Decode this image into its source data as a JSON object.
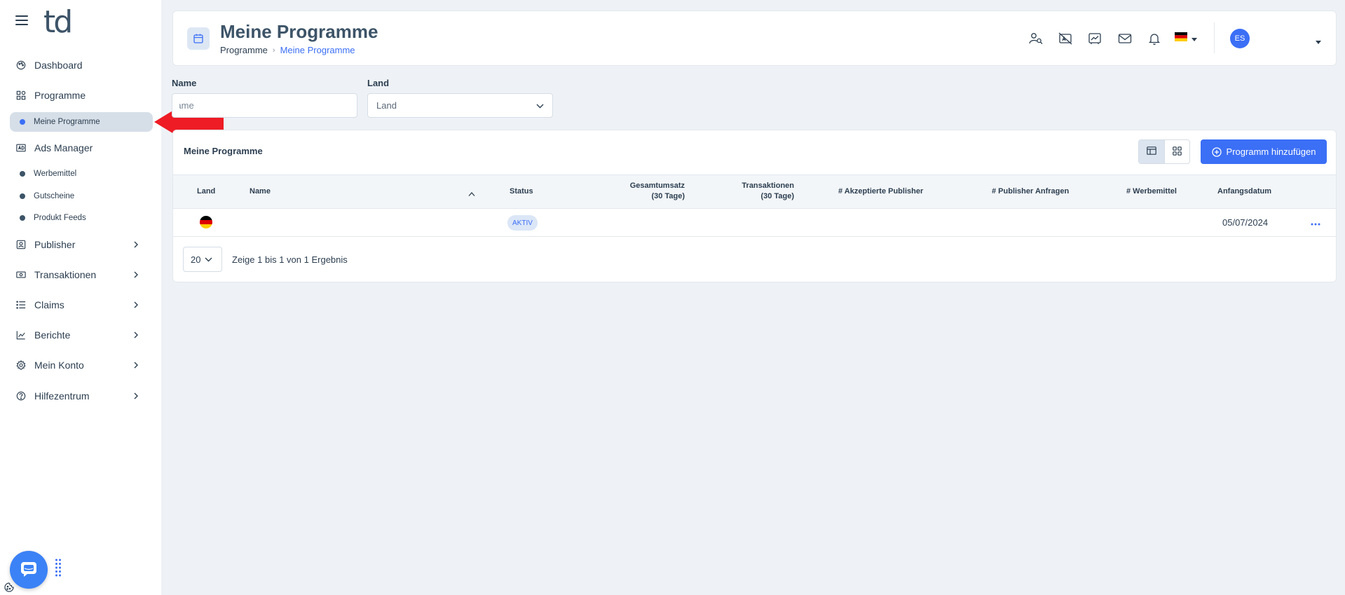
{
  "brand": {
    "logo_text": "td",
    "accent": "#3b6ff5"
  },
  "sidebar": {
    "items": [
      {
        "label": "Dashboard",
        "icon": "palette-icon"
      },
      {
        "label": "Programme",
        "icon": "grid-icon"
      },
      {
        "label": "Meine Programme",
        "active": true
      },
      {
        "label": "Ads Manager",
        "icon": "ad-icon"
      },
      {
        "label": "Werbemittel"
      },
      {
        "label": "Gutscheine"
      },
      {
        "label": "Produkt Feeds"
      },
      {
        "label": "Publisher",
        "icon": "user-badge-icon",
        "expandable": true
      },
      {
        "label": "Transaktionen",
        "icon": "money-icon",
        "expandable": true
      },
      {
        "label": "Claims",
        "icon": "list-icon",
        "expandable": true
      },
      {
        "label": "Berichte",
        "icon": "chart-line-icon",
        "expandable": true
      },
      {
        "label": "Mein Konto",
        "icon": "gear-icon",
        "expandable": true
      },
      {
        "label": "Hilfezentrum",
        "icon": "help-icon",
        "expandable": true
      }
    ]
  },
  "header": {
    "title": "Meine Programme",
    "breadcrumb": {
      "root": "Programme",
      "current": "Meine Programme"
    },
    "user": {
      "initials": "ES"
    },
    "language": "de"
  },
  "filters": {
    "name_label": "Name",
    "name_placeholder": "Name",
    "land_label": "Land",
    "land_value": "Land"
  },
  "table": {
    "title": "Meine Programme",
    "add_button_label": "Programm hinzufügen",
    "columns": {
      "land": "Land",
      "name": "Name",
      "status": "Status",
      "gesamtumsatz": "Gesamtumsatz",
      "gesamtumsatz_sub": "(30 Tage)",
      "transaktionen": "Transaktionen",
      "transaktionen_sub": "(30 Tage)",
      "akzeptierte": "# Akzeptierte Publisher",
      "anfragen": "# Publisher Anfragen",
      "werbemittel": "# Werbemittel",
      "anfangsdatum": "Anfangsdatum"
    },
    "rows": [
      {
        "land": "DE",
        "name": "",
        "status": "AKTIV",
        "gesamtumsatz": "",
        "transaktionen": "",
        "akzeptierte": "",
        "anfragen": "",
        "werbemittel": "",
        "anfangsdatum": "05/07/2024"
      }
    ],
    "page_size": "20",
    "page_info": "Zeige 1 bis 1 von 1 Ergebnis"
  }
}
